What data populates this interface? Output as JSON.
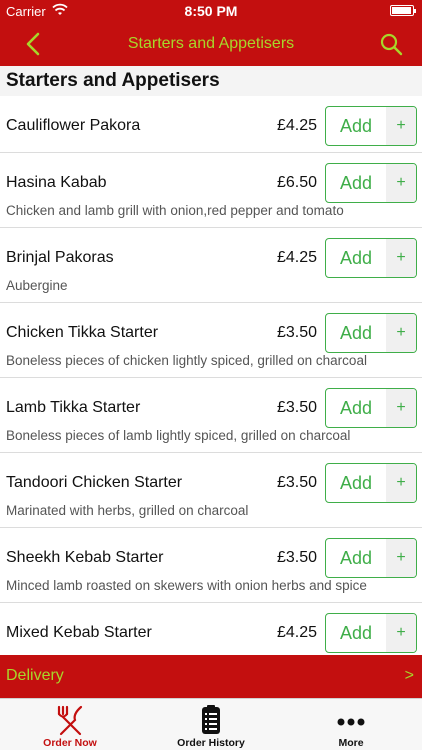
{
  "status_bar": {
    "carrier": "Carrier",
    "time": "8:50 PM"
  },
  "nav": {
    "title": "Starters and Appetisers",
    "back_icon": "chevron-left-icon",
    "search_icon": "search-icon"
  },
  "section": {
    "title": "Starters and Appetisers"
  },
  "items": [
    {
      "name": "Cauliflower Pakora",
      "price": "£4.25",
      "description": "",
      "add_label": "Add",
      "plus_label": "+"
    },
    {
      "name": "Hasina Kabab",
      "price": "£6.50",
      "description": "Chicken and lamb grill with onion,red pepper and tomato",
      "add_label": "Add",
      "plus_label": "+"
    },
    {
      "name": "Brinjal Pakoras",
      "price": "£4.25",
      "description": "Aubergine",
      "add_label": "Add",
      "plus_label": "+"
    },
    {
      "name": "Chicken Tikka Starter",
      "price": "£3.50",
      "description": "Boneless pieces of chicken lightly spiced, grilled on charcoal",
      "add_label": "Add",
      "plus_label": "+"
    },
    {
      "name": "Lamb Tikka Starter",
      "price": "£3.50",
      "description": "Boneless pieces of lamb lightly spiced, grilled on charcoal",
      "add_label": "Add",
      "plus_label": "+"
    },
    {
      "name": "Tandoori Chicken Starter",
      "price": "£3.50",
      "description": "Marinated with herbs, grilled on charcoal",
      "add_label": "Add",
      "plus_label": "+"
    },
    {
      "name": "Sheekh Kebab Starter",
      "price": "£3.50",
      "description": "Minced lamb roasted on skewers with onion herbs and spice",
      "add_label": "Add",
      "plus_label": "+"
    },
    {
      "name": "Mixed Kebab Starter",
      "price": "£4.25",
      "description": "",
      "add_label": "Add",
      "plus_label": "+"
    }
  ],
  "delivery": {
    "label": "Delivery",
    "arrow": ">"
  },
  "tabs": [
    {
      "label": "Order Now",
      "icon": "fork-knife-icon",
      "active": true
    },
    {
      "label": "Order History",
      "icon": "clipboard-list-icon",
      "active": false
    },
    {
      "label": "More",
      "icon": "more-dots-icon",
      "active": false
    }
  ],
  "colors": {
    "brand_red": "#c30f0f",
    "accent_lime": "#a8d62a",
    "add_green": "#3fae49"
  }
}
